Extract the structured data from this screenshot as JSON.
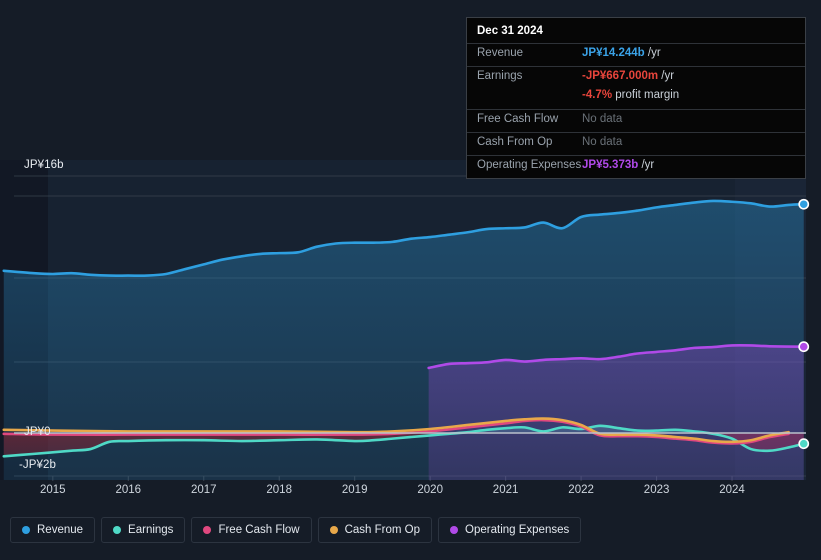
{
  "tooltip": {
    "date": "Dec 31 2024",
    "rows": [
      {
        "label": "Revenue",
        "value": "JP¥14.244b",
        "unit": "/yr",
        "color": "#3ba3e8",
        "nodata": false
      },
      {
        "label": "Earnings",
        "value": "-JP¥667.000m",
        "unit": "/yr",
        "color": "#e8453c",
        "nodata": false
      },
      {
        "label": "",
        "value": "-4.7%",
        "unit": "profit margin",
        "color": "#e8453c",
        "nodata": false
      },
      {
        "label": "Free Cash Flow",
        "value": "No data",
        "unit": "",
        "color": "#6a7178",
        "nodata": true
      },
      {
        "label": "Cash From Op",
        "value": "No data",
        "unit": "",
        "color": "#6a7178",
        "nodata": true
      },
      {
        "label": "Operating Expenses",
        "value": "JP¥5.373b",
        "unit": "/yr",
        "color": "#b04ae8",
        "nodata": false
      }
    ]
  },
  "legend": {
    "items": [
      {
        "label": "Revenue",
        "color": "#2e9fe0"
      },
      {
        "label": "Earnings",
        "color": "#4fd9c6"
      },
      {
        "label": "Free Cash Flow",
        "color": "#e0487f"
      },
      {
        "label": "Cash From Op",
        "color": "#e8a84a"
      },
      {
        "label": "Operating Expenses",
        "color": "#b04ae8"
      }
    ]
  },
  "axes": {
    "y_top_label": "JP¥16b",
    "y_zero_label": "JP¥0",
    "y_neg_label": "-JP¥2b",
    "x_labels": [
      "2015",
      "2016",
      "2017",
      "2018",
      "2019",
      "2020",
      "2021",
      "2022",
      "2023",
      "2024"
    ]
  },
  "chart_data": {
    "type": "line",
    "title": "",
    "xlabel": "",
    "ylabel": "JP¥",
    "ylim": [
      -2.5,
      16.5
    ],
    "xlim": [
      2014.3,
      2024.98
    ],
    "grid": true,
    "legend_position": "bottom",
    "currency": "JP¥",
    "units": "billions",
    "y_ticks": [
      16,
      0,
      -2
    ],
    "x_ticks": [
      "2015",
      "2016",
      "2017",
      "2018",
      "2019",
      "2020",
      "2021",
      "2022",
      "2023",
      "2024"
    ],
    "series": [
      {
        "name": "Revenue",
        "color": "#2e9fe0",
        "filled": true,
        "end_marker": true,
        "x": [
          2014.35,
          2014.75,
          2015.0,
          2015.25,
          2015.5,
          2015.75,
          2016.0,
          2016.25,
          2016.5,
          2016.75,
          2017.0,
          2017.25,
          2017.5,
          2017.75,
          2018.0,
          2018.25,
          2018.5,
          2018.75,
          2019.0,
          2019.25,
          2019.5,
          2019.75,
          2020.0,
          2020.25,
          2020.5,
          2020.75,
          2021.0,
          2021.25,
          2021.5,
          2021.75,
          2022.0,
          2022.25,
          2022.5,
          2022.75,
          2023.0,
          2023.25,
          2023.5,
          2023.75,
          2024.0,
          2024.25,
          2024.5,
          2024.75,
          2024.95
        ],
        "values": [
          10.1,
          9.95,
          9.9,
          9.95,
          9.85,
          9.8,
          9.8,
          9.8,
          9.9,
          10.2,
          10.5,
          10.8,
          11.0,
          11.15,
          11.2,
          11.25,
          11.6,
          11.8,
          11.85,
          11.85,
          11.9,
          12.1,
          12.2,
          12.35,
          12.5,
          12.7,
          12.75,
          12.8,
          13.1,
          12.75,
          13.45,
          13.6,
          13.7,
          13.85,
          14.05,
          14.2,
          14.35,
          14.45,
          14.4,
          14.3,
          14.1,
          14.2,
          14.244
        ]
      },
      {
        "name": "Earnings",
        "color": "#4fd9c6",
        "filled": true,
        "end_marker": true,
        "x": [
          2014.35,
          2014.75,
          2015.0,
          2015.25,
          2015.5,
          2015.75,
          2016.0,
          2016.5,
          2017.0,
          2017.5,
          2018.0,
          2018.5,
          2019.0,
          2019.25,
          2019.5,
          2019.75,
          2020.0,
          2020.25,
          2020.5,
          2020.75,
          2021.0,
          2021.25,
          2021.5,
          2021.75,
          2022.0,
          2022.25,
          2022.5,
          2022.75,
          2023.0,
          2023.25,
          2023.5,
          2023.75,
          2024.0,
          2024.25,
          2024.5,
          2024.75,
          2024.95
        ],
        "values": [
          -1.45,
          -1.3,
          -1.2,
          -1.1,
          -1.0,
          -0.55,
          -0.5,
          -0.45,
          -0.45,
          -0.5,
          -0.45,
          -0.4,
          -0.5,
          -0.45,
          -0.35,
          -0.25,
          -0.15,
          -0.05,
          0.05,
          0.2,
          0.3,
          0.35,
          0.1,
          0.35,
          0.25,
          0.45,
          0.3,
          0.15,
          0.15,
          0.2,
          0.1,
          -0.05,
          -0.35,
          -1.0,
          -1.1,
          -0.9,
          -0.667
        ]
      },
      {
        "name": "Free Cash Flow",
        "color": "#e0487f",
        "filled": false,
        "end_marker": false,
        "x": [
          2014.35,
          2015.0,
          2016.0,
          2017.0,
          2018.0,
          2019.0,
          2019.5,
          2020.0,
          2020.5,
          2021.0,
          2021.25,
          2021.5,
          2021.75,
          2022.0,
          2022.25,
          2022.5,
          2022.75,
          2023.0,
          2023.25,
          2023.5,
          2023.75,
          2024.0,
          2024.25,
          2024.5,
          2024.75
        ],
        "values": [
          -0.05,
          -0.1,
          -0.1,
          -0.1,
          -0.1,
          -0.1,
          -0.05,
          0.1,
          0.35,
          0.6,
          0.75,
          0.8,
          0.7,
          0.4,
          -0.15,
          -0.2,
          -0.2,
          -0.25,
          -0.35,
          -0.45,
          -0.6,
          -0.65,
          -0.55,
          -0.25,
          -0.05
        ]
      },
      {
        "name": "Cash From Op",
        "color": "#e8a84a",
        "filled": false,
        "end_marker": false,
        "x": [
          2014.35,
          2015.0,
          2016.0,
          2017.0,
          2018.0,
          2019.0,
          2019.5,
          2020.0,
          2020.5,
          2021.0,
          2021.25,
          2021.5,
          2021.75,
          2022.0,
          2022.25,
          2022.5,
          2022.75,
          2023.0,
          2023.25,
          2023.5,
          2023.75,
          2024.0,
          2024.25,
          2024.5,
          2024.75
        ],
        "values": [
          0.2,
          0.15,
          0.1,
          0.1,
          0.1,
          0.05,
          0.1,
          0.25,
          0.5,
          0.75,
          0.85,
          0.9,
          0.8,
          0.5,
          -0.05,
          -0.1,
          -0.1,
          -0.15,
          -0.25,
          -0.35,
          -0.5,
          -0.55,
          -0.45,
          -0.15,
          0.05
        ]
      },
      {
        "name": "Operating Expenses",
        "color": "#b04ae8",
        "filled": true,
        "end_marker": true,
        "x": [
          2019.98,
          2020.25,
          2020.5,
          2020.75,
          2021.0,
          2021.25,
          2021.5,
          2021.75,
          2022.0,
          2022.25,
          2022.5,
          2022.75,
          2023.0,
          2023.25,
          2023.5,
          2023.75,
          2024.0,
          2024.25,
          2024.5,
          2024.95
        ],
        "values": [
          4.05,
          4.3,
          4.35,
          4.4,
          4.55,
          4.45,
          4.55,
          4.6,
          4.65,
          4.6,
          4.75,
          4.95,
          5.05,
          5.15,
          5.3,
          5.35,
          5.45,
          5.45,
          5.4,
          5.373
        ]
      }
    ]
  }
}
